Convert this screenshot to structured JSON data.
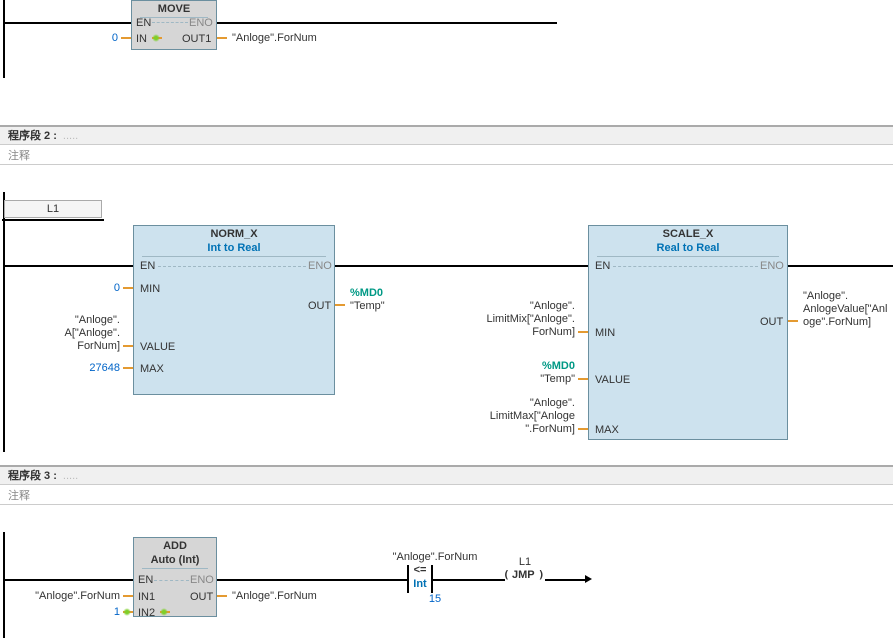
{
  "network1": {
    "block": {
      "title": "MOVE",
      "pins": {
        "en": "EN",
        "eno": "ENO",
        "in": "IN",
        "out1": "OUT1"
      }
    },
    "in_value": "0",
    "out_label": "\"Anloge\".ForNum"
  },
  "network2": {
    "header": "程序段 2 :",
    "comment": "注释",
    "label": "L1",
    "normx": {
      "title": "NORM_X",
      "sub": "Int  to  Real",
      "pins": {
        "en": "EN",
        "eno": "ENO",
        "min": "MIN",
        "value": "VALUE",
        "max": "MAX",
        "out": "OUT"
      },
      "min_val": "0",
      "value_label_l1": "\"Anloge\".",
      "value_label_l2": "A[\"Anloge\".",
      "value_label_l3": "ForNum]",
      "max_val": "27648",
      "out_tag": "%MD0",
      "out_name": "\"Temp\""
    },
    "scalex": {
      "title": "SCALE_X",
      "sub": "Real  to  Real",
      "pins": {
        "en": "EN",
        "eno": "ENO",
        "min": "MIN",
        "value": "VALUE",
        "max": "MAX",
        "out": "OUT"
      },
      "min_l1": "\"Anloge\".",
      "min_l2": "LimitMix[\"Anloge\".",
      "min_l3": "ForNum]",
      "val_tag": "%MD0",
      "val_name": "\"Temp\"",
      "max_l1": "\"Anloge\".",
      "max_l2": "LimitMax[\"Anloge",
      "max_l3": "\".ForNum]",
      "out_l1": "\"Anloge\".",
      "out_l2": "AnlogeValue[\"Anl",
      "out_l3": "oge\".ForNum]"
    }
  },
  "network3": {
    "header": "程序段 3 :",
    "comment": "注释",
    "add": {
      "title": "ADD",
      "sub": "Auto (Int)",
      "pins": {
        "en": "EN",
        "eno": "ENO",
        "in1": "IN1",
        "in2": "IN2",
        "out": "OUT"
      },
      "in1_val": "\"Anloge\".ForNum",
      "in2_val": "1",
      "out_val": "\"Anloge\".ForNum"
    },
    "compare": {
      "top_label": "\"Anloge\".ForNum",
      "op": "<=",
      "type": "Int",
      "rhs": "15"
    },
    "jump": {
      "label": "L1",
      "name": "JMP"
    }
  }
}
